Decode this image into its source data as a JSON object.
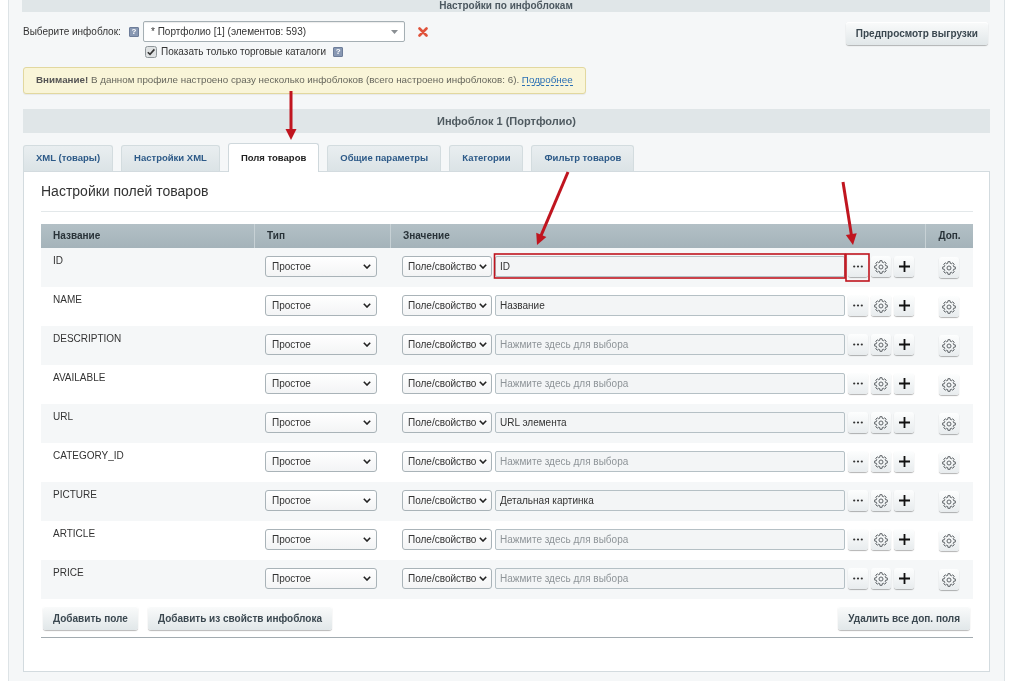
{
  "page_header": {
    "title": "Настройки по инфоблокам"
  },
  "infoblock_picker": {
    "label": "Выберите инфоблок:",
    "help": "?",
    "value": "* Портфолио [1] (элементов: 593)",
    "catalog_only": {
      "label": "Показать только торговые каталоги",
      "checked": true,
      "help": "?"
    }
  },
  "preview_button": "Предпросмотр выгрузки",
  "alert": {
    "text": "**Внимание!** В данном профиле настроено сразу несколько инфоблоков (всего настроено инфоблоков: 6).",
    "link": "Подробнее"
  },
  "infoblock_header": "Инфоблок 1 (Портфолио)",
  "tabs": [
    {
      "label": "XML (товары)",
      "selected": false,
      "annotated": false
    },
    {
      "label": "Настройки XML",
      "selected": false,
      "annotated": false
    },
    {
      "label": "Поля товаров",
      "selected": true,
      "annotated": true
    },
    {
      "label": "Общие параметры",
      "selected": false,
      "annotated": false
    },
    {
      "label": "Категории",
      "selected": false,
      "annotated": false
    },
    {
      "label": "Фильтр товаров",
      "selected": false,
      "annotated": false
    }
  ],
  "section_title": "Настройки полей товаров",
  "table": {
    "columns": [
      "Название",
      "Тип",
      "Значение",
      "Доп."
    ],
    "rows": [
      {
        "name": "ID",
        "type": "Простое",
        "source": "Поле/свойство",
        "value": "ID",
        "annotated": true
      },
      {
        "name": "NAME",
        "type": "Простое",
        "source": "Поле/свойство",
        "value": "Название",
        "annotated": false
      },
      {
        "name": "DESCRIPTION",
        "type": "Простое",
        "source": "Поле/свойство",
        "placeholder": "Нажмите здесь для выбора",
        "annotated": false
      },
      {
        "name": "AVAILABLE",
        "type": "Простое",
        "source": "Поле/свойство",
        "placeholder": "Нажмите здесь для выбора",
        "annotated": false
      },
      {
        "name": "URL",
        "type": "Простое",
        "source": "Поле/свойство",
        "value": "URL элемента",
        "annotated": false
      },
      {
        "name": "CATEGORY_ID",
        "type": "Простое",
        "source": "Поле/свойство",
        "placeholder": "Нажмите здесь для выбора",
        "annotated": false
      },
      {
        "name": "PICTURE",
        "type": "Простое",
        "source": "Поле/свойство",
        "value": "Детальная картинка",
        "annotated": false
      },
      {
        "name": "ARTICLE",
        "type": "Простое",
        "source": "Поле/свойство",
        "placeholder": "Нажмите здесь для выбора",
        "annotated": false
      },
      {
        "name": "PRICE",
        "type": "Простое",
        "source": "Поле/свойство",
        "placeholder": "Нажмите здесь для выбора",
        "annotated": false
      }
    ]
  },
  "add_buttons": [
    "Добавить поле",
    "Добавить из свойств инфоблока"
  ],
  "remove_all_button": "Удалить все доп. поля"
}
